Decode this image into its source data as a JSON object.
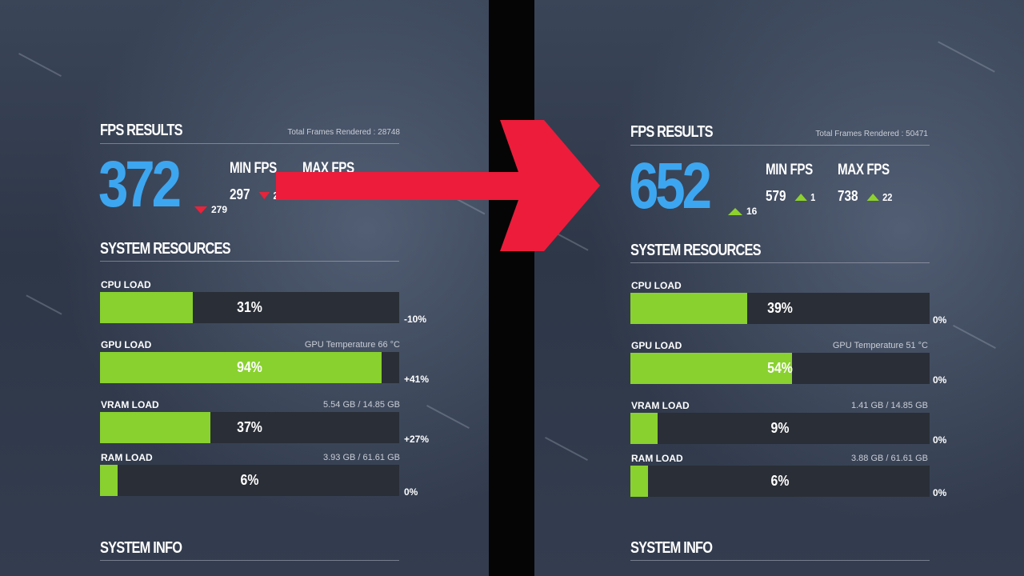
{
  "left": {
    "fps_title": "FPS RESULTS",
    "total_frames": "Total Frames Rendered : 28748",
    "avg_fps": "372",
    "avg_delta": "279",
    "min_label": "MIN FPS",
    "min_value": "297",
    "min_delta": "2",
    "max_label": "MAX FPS",
    "resources_title": "SYSTEM RESOURCES",
    "cpu": {
      "label": "CPU LOAD",
      "info": "",
      "percent": 31,
      "text": "31%",
      "delta": "-10%"
    },
    "gpu": {
      "label": "GPU LOAD",
      "info": "GPU Temperature 66 °C",
      "percent": 94,
      "text": "94%",
      "delta": "+41%"
    },
    "vram": {
      "label": "VRAM LOAD",
      "info": "5.54 GB / 14.85 GB",
      "percent": 37,
      "text": "37%",
      "delta": "+27%"
    },
    "ram": {
      "label": "RAM LOAD",
      "info": "3.93 GB / 61.61 GB",
      "percent": 6,
      "text": "6%",
      "delta": "0%"
    },
    "info_title": "SYSTEM INFO"
  },
  "right": {
    "fps_title": "FPS RESULTS",
    "total_frames": "Total Frames Rendered : 50471",
    "avg_fps": "652",
    "avg_delta": "16",
    "min_label": "MIN FPS",
    "min_value": "579",
    "min_delta": "1",
    "max_label": "MAX FPS",
    "max_value": "738",
    "max_delta": "22",
    "resources_title": "SYSTEM RESOURCES",
    "cpu": {
      "label": "CPU LOAD",
      "info": "",
      "percent": 39,
      "text": "39%",
      "delta": "0%"
    },
    "gpu": {
      "label": "GPU LOAD",
      "info": "GPU Temperature 51 °C",
      "percent": 54,
      "text": "54%",
      "delta": "0%"
    },
    "vram": {
      "label": "VRAM LOAD",
      "info": "1.41 GB / 14.85 GB",
      "percent": 9,
      "text": "9%",
      "delta": "0%"
    },
    "ram": {
      "label": "RAM LOAD",
      "info": "3.88 GB / 61.61 GB",
      "percent": 6,
      "text": "6%",
      "delta": "0%"
    },
    "info_title": "SYSTEM INFO"
  },
  "colors": {
    "fps_blue": "#3da6f0",
    "bar_green": "#89d12e",
    "bar_track": "#2a2e36",
    "down_red": "#e8233a",
    "up_green": "#8ed12f",
    "arrow_red": "#ed1c3a"
  },
  "icons": {
    "comparison_arrow": "right-arrow-icon",
    "decrease": "triangle-down-icon",
    "increase": "triangle-up-icon"
  }
}
